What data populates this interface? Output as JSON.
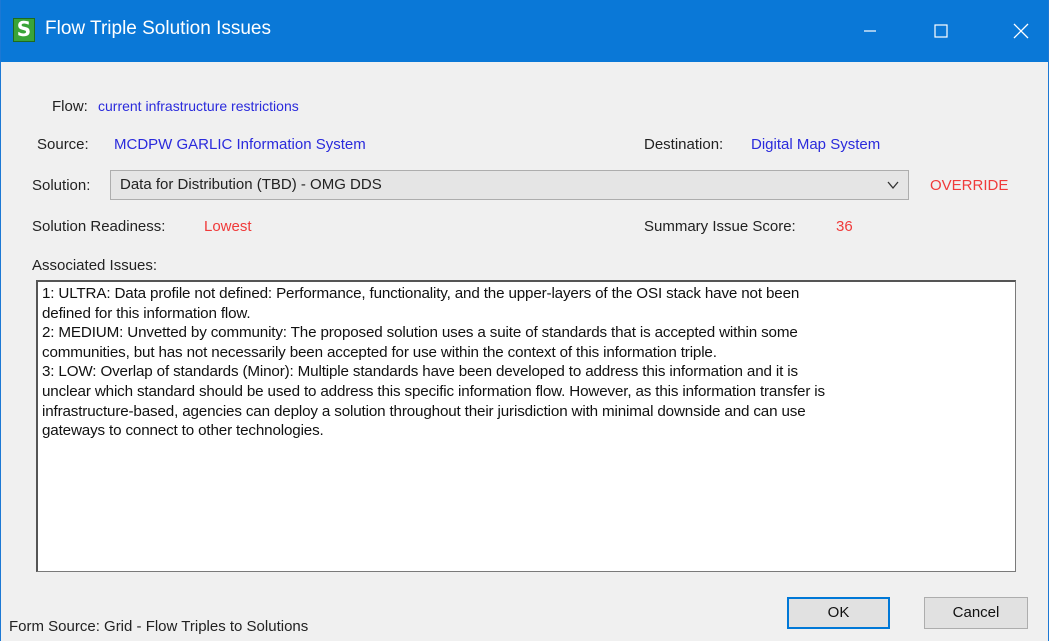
{
  "window": {
    "title": "Flow Triple Solution Issues",
    "app_icon_letter": "S"
  },
  "flow": {
    "label": "Flow:",
    "value": "current infrastructure restrictions"
  },
  "source": {
    "label": "Source:",
    "value": "MCDPW GARLIC Information System"
  },
  "destination": {
    "label": "Destination:",
    "value": "Digital Map System"
  },
  "solution": {
    "label": "Solution:",
    "selected": "Data for Distribution (TBD) - OMG DDS",
    "override_label": "OVERRIDE"
  },
  "readiness": {
    "label": "Solution Readiness:",
    "value": "Lowest"
  },
  "summary_score": {
    "label": "Summary Issue Score:",
    "value": "36"
  },
  "issues": {
    "label": "Associated Issues:",
    "lines": [
      "1: ULTRA: Data profile not defined: Performance, functionality, and the upper-layers of the OSI stack have not been",
      "defined for this information flow.",
      "2: MEDIUM: Unvetted by community: The proposed solution uses a suite of standards that is accepted within some",
      "communities, but has not necessarily been accepted for use within the context of this information triple.",
      "3: LOW: Overlap of standards (Minor): Multiple standards have been developed to address this information and it is",
      "unclear which standard should be used to address this specific information flow. However, as this information transfer is",
      "infrastructure-based, agencies can deploy a solution throughout their jurisdiction with minimal downside and can use",
      "gateways to connect to other technologies."
    ]
  },
  "footer": {
    "form_source": "Form Source: Grid - Flow Triples to Solutions"
  },
  "buttons": {
    "ok": "OK",
    "cancel": "Cancel"
  },
  "colors": {
    "titlebar": "#0a78d7",
    "link_blue": "#2a2adc",
    "alert_red": "#f03a3a"
  }
}
